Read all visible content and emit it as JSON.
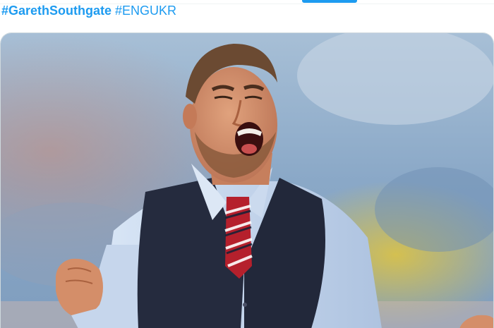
{
  "tweet": {
    "hashtags": [
      "#GarethSouthgate",
      "#ENGUKR"
    ]
  },
  "media": {
    "icon": "photo-of-celebrating-man",
    "colors": {
      "stand_blue": "#7fa3c6",
      "shirt_blue": "#c7d8ee",
      "waistcoat_navy": "#252b3e",
      "tie_red": "#b5202c",
      "skin": "#d08d6a"
    }
  }
}
